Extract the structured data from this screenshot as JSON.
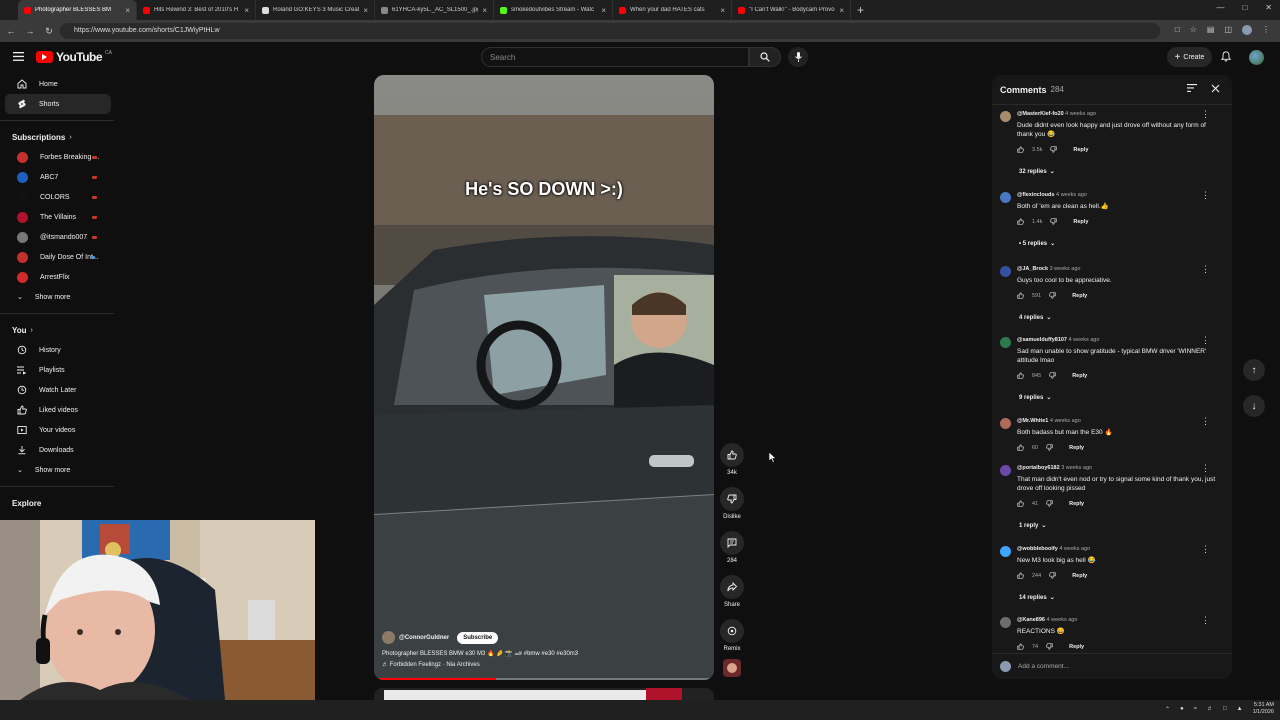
{
  "browser": {
    "tabs": [
      {
        "label": "Photographer BLESSES BM",
        "active": true,
        "favicon_color": "#ff0000"
      },
      {
        "label": "Hits Rewind 3: Best of 2010's H",
        "active": false,
        "favicon_color": "#ff0000"
      },
      {
        "label": "Roland GO:KEYS 3 Music Creati",
        "active": false,
        "favicon_color": "#dddddd"
      },
      {
        "label": "61YHCA-ky5L._AC_SL1500_.jpg",
        "active": false,
        "favicon_color": "#888888"
      },
      {
        "label": "smokedoutvibes Stream - Watc",
        "active": false,
        "favicon_color": "#53fc18"
      },
      {
        "label": "When your dad HATES cats",
        "active": false,
        "favicon_color": "#ff0000"
      },
      {
        "label": "\"I Can't Walk!\" - Bodycam Provo",
        "active": false,
        "favicon_color": "#ff0000"
      }
    ],
    "url": "https://www.youtube.com/shorts/C1JWiyPtHLw"
  },
  "header": {
    "logo_text": "YouTube",
    "country": "CA",
    "search_placeholder": "Search",
    "create_label": "Create"
  },
  "sidebar": {
    "main": [
      {
        "label": "Home",
        "icon": "home-icon",
        "active": false
      },
      {
        "label": "Shorts",
        "icon": "shorts-icon",
        "active": true
      }
    ],
    "subscriptions_title": "Subscriptions",
    "subscriptions": [
      {
        "label": "Forbes Breaking ...",
        "color": "#c4302b",
        "status": "live"
      },
      {
        "label": "ABC7",
        "color": "#1d5fbf",
        "status": "live"
      },
      {
        "label": "COLORS",
        "color": "#111111",
        "status": "live"
      },
      {
        "label": "The Villains",
        "color": "#b0122b",
        "status": "live"
      },
      {
        "label": "@itsmando007",
        "color": "#777777",
        "status": "live"
      },
      {
        "label": "Daily Dose Of Int...",
        "color": "#c4302b",
        "status": "new"
      },
      {
        "label": "ArrestFlix",
        "color": "#d12a2a",
        "status": "none"
      }
    ],
    "show_more": "Show more",
    "you_title": "You",
    "you_items": [
      {
        "label": "History",
        "icon": "history-icon"
      },
      {
        "label": "Playlists",
        "icon": "playlists-icon"
      },
      {
        "label": "Watch Later",
        "icon": "watch-later-icon"
      },
      {
        "label": "Liked videos",
        "icon": "liked-videos-icon"
      },
      {
        "label": "Your videos",
        "icon": "your-videos-icon"
      },
      {
        "label": "Downloads",
        "icon": "downloads-icon"
      }
    ],
    "show_more_2": "Show more",
    "explore_title": "Explore"
  },
  "short": {
    "caption": "He's SO DOWN >:)",
    "channel": "@ConnorGuldner",
    "subscribe_label": "Subscribe",
    "title": "Photographer BLESSES BMW e30 M3 🔥 🤌 📸 🏎 #bmw #e30 #e30m3",
    "sound": "♬ Forbidden Feelingz · Nia Archives",
    "progress": 0.36
  },
  "actions": {
    "like_count": "34k",
    "dislike_label": "Dislike",
    "comment_count": "284",
    "share_label": "Share",
    "remix_label": "Remix"
  },
  "comments": {
    "title": "Comments",
    "count": "284",
    "add_placeholder": "Add a comment...",
    "items": [
      {
        "author": "@MasterKief-fo20",
        "ago": "4 weeks ago",
        "text": "Dude didnt even look happy and just drove off without any form of thank you 😂",
        "likes": "3.5k",
        "replies": "32 replies",
        "avatar": "#a78c6d"
      },
      {
        "author": "@flexinclouds",
        "ago": "4 weeks ago",
        "text": "Both of 'em are clean as hell.👍",
        "likes": "1.4k",
        "replies": "• 5 replies",
        "avatar": "#4a78c0"
      },
      {
        "author": "@JA_Brock",
        "ago": "3 weeks ago",
        "text": "Guys too cool to be appreciative.",
        "likes": "591",
        "replies": "4 replies",
        "avatar": "#3550a0"
      },
      {
        "author": "@samuelduffy8107",
        "ago": "4 weeks ago",
        "text": "Sad man unable to show gratitude - typical BMW driver 'WINNER' attitude lmao",
        "likes": "845",
        "replies": "9 replies",
        "avatar": "#2c7a4a"
      },
      {
        "author": "@Mr.White1",
        "ago": "4 weeks ago",
        "text": "Both badass but man the E30 🔥",
        "likes": "60",
        "replies": "",
        "avatar": "#b06a5b"
      },
      {
        "author": "@portalboy6182",
        "ago": "3 weeks ago",
        "text": "That man didn't even nod or try to signal some kind of thank you, just drove off looking pissed",
        "likes": "41",
        "replies": "1 reply",
        "avatar": "#6a4aa8"
      },
      {
        "author": "@wobblebooify",
        "ago": "4 weeks ago",
        "text": "New M3 look big as hell 😂",
        "likes": "244",
        "replies": "14 replies",
        "avatar": "#3ea6ff"
      },
      {
        "author": "@Kane896",
        "ago": "4 weeks ago",
        "text": "REACTIONS 😄",
        "likes": "74",
        "replies": "",
        "avatar": "#6d6d6d"
      }
    ],
    "reply_label": "Reply"
  },
  "taskbar": {
    "time": "5:31 AM",
    "date": "1/1/2026"
  }
}
